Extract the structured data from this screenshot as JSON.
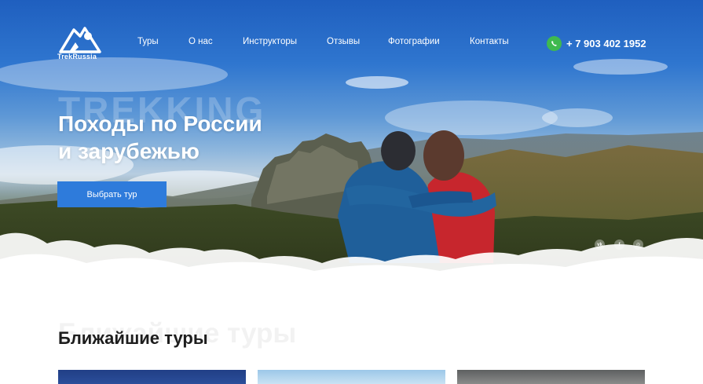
{
  "brand": {
    "name": "TrekRussia"
  },
  "nav": {
    "items": [
      {
        "label": "Туры"
      },
      {
        "label": "О нас"
      },
      {
        "label": "Инструкторы"
      },
      {
        "label": "Отзывы"
      },
      {
        "label": "Фотографии"
      },
      {
        "label": "Контакты"
      }
    ]
  },
  "contact": {
    "phone": "+ 7 903 402 1952",
    "icon": "whatsapp-icon",
    "icon_color": "#3fb94f"
  },
  "hero": {
    "background_word": "TREKKING",
    "title_line1": "Походы по России",
    "title_line2": "и зарубежью",
    "cta_label": "Выбрать тур",
    "accent_color": "#2e7bdb"
  },
  "socials": [
    {
      "icon": "vk-icon",
      "label": "vk"
    },
    {
      "icon": "facebook-icon",
      "label": "f"
    },
    {
      "icon": "instagram-icon",
      "label": "◎"
    }
  ],
  "tours_section": {
    "background_word": "Ближайшие туры",
    "title": "Ближайшие туры"
  }
}
